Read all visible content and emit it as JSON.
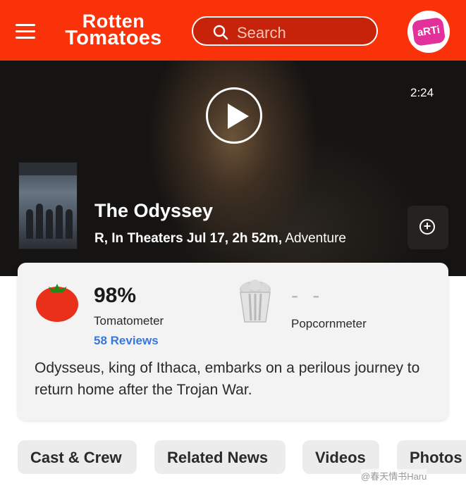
{
  "header": {
    "logo_line1": "Rotten",
    "logo_line2": "Tomatoes",
    "search_placeholder": "Search",
    "avatar_text": "aRTi"
  },
  "hero": {
    "duration": "2:24",
    "title": "The Odyssey",
    "meta_bold": "R, In Theaters Jul 17, 2h 52m,",
    "genre": "Adventure"
  },
  "scores": {
    "tomatometer_value": "98%",
    "tomatometer_label": "Tomatometer",
    "reviews_link": "58 Reviews",
    "popcornmeter_value": "- -",
    "popcornmeter_label": "Popcornmeter"
  },
  "synopsis": "Odysseus, king of Ithaca, embarks on a perilous journey to return home after the Trojan War.",
  "tabs": [
    {
      "label": "Cast & Crew"
    },
    {
      "label": "Related News"
    },
    {
      "label": "Videos"
    },
    {
      "label": "Photos"
    }
  ],
  "watermark": "@春天情书Haru",
  "colors": {
    "brand": "#fa320a",
    "link": "#3976dc",
    "tomato_red": "#e8301a"
  }
}
